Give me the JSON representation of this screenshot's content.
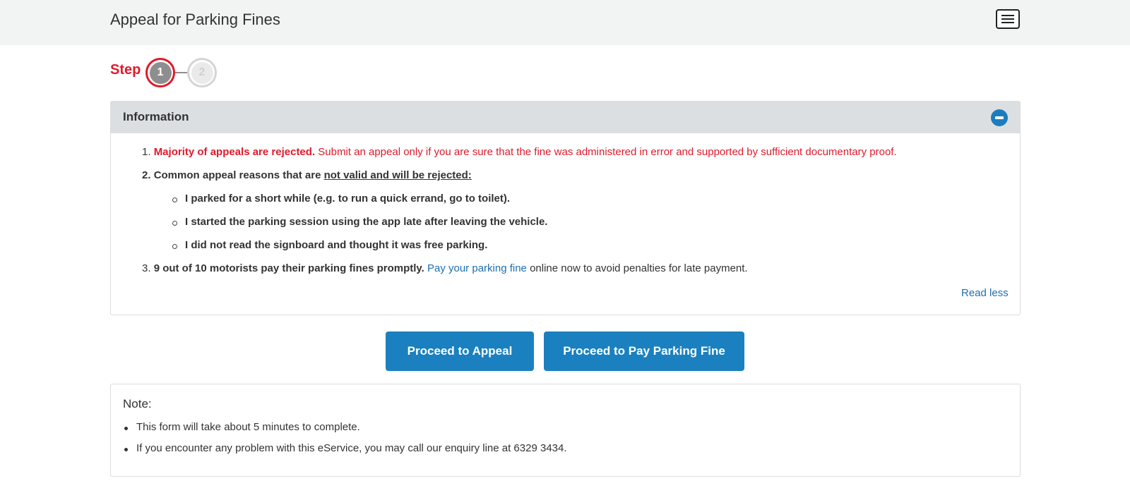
{
  "header": {
    "title": "Appeal for Parking Fines",
    "menu_icon": "hamburger-menu-icon"
  },
  "stepper": {
    "label": "Step",
    "steps": [
      "1",
      "2"
    ],
    "current": 1
  },
  "info": {
    "title": "Information",
    "items": [
      {
        "number": "1.",
        "bold": "Majority of appeals are rejected.",
        "text": " Submit an appeal only if you are sure that the fine was administered in error and supported by sufficient documentary proof."
      },
      {
        "number": "2.",
        "bold": "Common appeal reasons that are ",
        "underlined": "not valid and will be rejected:"
      },
      {
        "number": "3.",
        "bold": "9 out of 10 motorists pay their parking fines promptly.",
        "link": "Pay your parking fine",
        "text": " online now to avoid penalties for late payment."
      }
    ],
    "invalid_reasons": [
      "I parked for a short while (e.g. to run a quick errand, go to toilet).",
      "I started the parking session using the app late after leaving the vehicle.",
      "I did not read the signboard and thought it was free parking."
    ],
    "read_less": "Read less"
  },
  "buttons": {
    "appeal": "Proceed to Appeal",
    "pay": "Proceed to Pay Parking Fine"
  },
  "note": {
    "title": "Note:",
    "items": [
      "This form will take about 5 minutes to complete.",
      "If you encounter any problem with this eService, you may call our enquiry line at 6329 3434."
    ]
  },
  "colors": {
    "accent": "#1b80bf",
    "alert": "#e01a2b",
    "header_bg": "#dcdfe2"
  }
}
